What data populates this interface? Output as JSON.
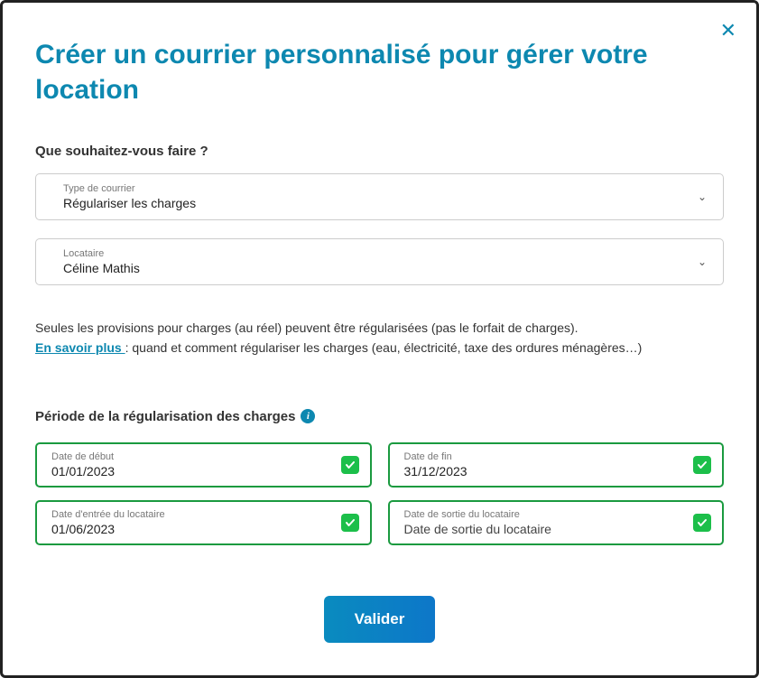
{
  "close_label": "✕",
  "title": "Créer un courrier personnalisé pour gérer votre location",
  "section1": {
    "heading": "Que souhaitez-vous faire ?",
    "type_label": "Type de courrier",
    "type_value": "Régulariser les charges",
    "tenant_label": "Locataire",
    "tenant_value": "Céline Mathis"
  },
  "info": {
    "line1": "Seules les provisions pour charges (au réel) peuvent être régularisées (pas le forfait de charges).",
    "link": "En savoir plus ",
    "line2_after": ": quand et comment régulariser les charges (eau, électricité, taxe des ordures ménagères…)"
  },
  "period": {
    "heading": "Période de la régularisation des charges",
    "fields": {
      "start": {
        "label": "Date de début",
        "value": "01/01/2023"
      },
      "end": {
        "label": "Date de fin",
        "value": "31/12/2023"
      },
      "entry": {
        "label": "Date d'entrée du locataire",
        "value": "01/06/2023"
      },
      "exit": {
        "label": "Date de sortie du locataire",
        "value": "Date de sortie du locataire",
        "is_placeholder": true
      }
    }
  },
  "submit": "Valider"
}
